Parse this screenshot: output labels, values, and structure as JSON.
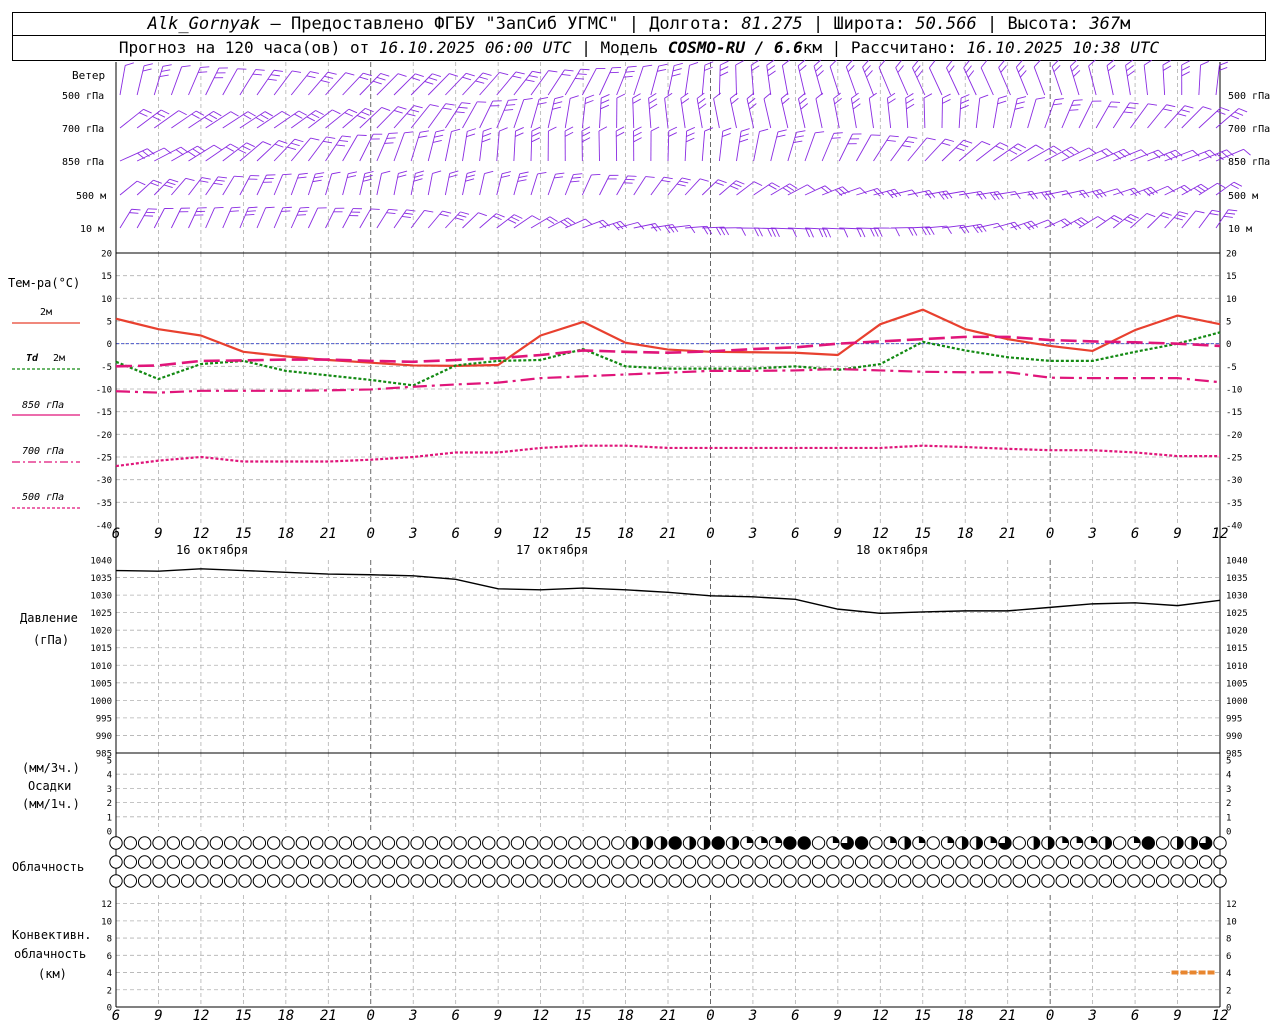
{
  "header": {
    "line1": {
      "station": "Alk_Gornyak",
      "provided_by": " – Предоставлено ФГБУ \"ЗапСиб УГМС\" | Долгота: ",
      "longitude": "81.275",
      "lat_label": " | Широта: ",
      "latitude": "50.566",
      "alt_label": " | Высота: ",
      "altitude": "367",
      "alt_unit": "м"
    },
    "line2": {
      "forecast_prefix": "Прогноз на 120 часа(ов) от ",
      "forecast_start": "16.10.2025 06:00 UTC",
      "model_label": " | Модель ",
      "model": "COSMO-RU / 6.6",
      "model_unit": "км",
      "computed_label": " | Рассчитано: ",
      "computed": "16.10.2025 10:38 UTC"
    }
  },
  "labels": {
    "wind": "Ветер",
    "wind_levels": [
      "500 гПа",
      "700 гПа",
      "850 гПа",
      "500 м",
      "10 м"
    ],
    "temp_title": "Тем-ра(°C)",
    "legend_t2m": "2м",
    "legend_td": "Td",
    "legend_td_suffix": "2м",
    "legend_850": "850 гПа",
    "legend_700": "700 гПа",
    "legend_500": "500 гПа",
    "pressure_title": "Давление",
    "pressure_unit": "(гПа)",
    "precip_unit1": "(мм/3ч.)",
    "precip_title": "Осадки",
    "precip_unit2": "(мм/1ч.)",
    "cloud_title": "Облачность",
    "conv_title1": "Конвективн.",
    "conv_title2": "облачность",
    "conv_unit": "(км)"
  },
  "colors": {
    "wind": "#8a2be2",
    "t2m": "#e8402f",
    "td2m": "#138a13",
    "t850": "#e0157a",
    "t700": "#e0157a",
    "t500": "#e0157a",
    "pressure": "#000000",
    "convective": "#e8862f",
    "grid": "#b0b0b0"
  },
  "chart_data": [
    {
      "type": "line",
      "title": "Тем-ра(°C)",
      "ylim": [
        -40,
        20
      ],
      "yticks": [
        20,
        15,
        10,
        5,
        0,
        -5,
        -10,
        -15,
        -20,
        -25,
        -30,
        -35,
        -40
      ],
      "x_ticks": [
        "6",
        "9",
        "12",
        "15",
        "18",
        "21",
        "0",
        "3",
        "6",
        "9",
        "12",
        "15",
        "18",
        "21",
        "0",
        "3",
        "6",
        "9",
        "12",
        "15",
        "18",
        "21",
        "0",
        "3",
        "6",
        "9",
        "12"
      ],
      "day_labels": [
        "16 октября",
        "17 октября",
        "18 октября"
      ],
      "x_hours": [
        0,
        3,
        6,
        9,
        12,
        15,
        18,
        21,
        24,
        27,
        30,
        33,
        36,
        39,
        42,
        45,
        48,
        51,
        54,
        57,
        60,
        63,
        66,
        69,
        72,
        75,
        78
      ],
      "series": [
        {
          "name": "2м",
          "values": [
            5.5,
            3.2,
            1.8,
            -1.8,
            -2.8,
            -3.6,
            -4.2,
            -4.8,
            -4.9,
            -4.7,
            1.8,
            4.8,
            0.2,
            -1.3,
            -1.8,
            -1.9,
            -2.0,
            -2.5,
            4.3,
            7.5,
            3.2,
            1.0,
            -0.5,
            -1.6,
            3.0,
            6.2,
            4.3
          ]
        },
        {
          "name": "Td 2м",
          "values": [
            -4.0,
            -7.8,
            -4.5,
            -3.8,
            -6.0,
            -7.0,
            -8.0,
            -9.2,
            -4.8,
            -3.8,
            -3.6,
            -1.2,
            -5.0,
            -5.5,
            -5.5,
            -5.5,
            -5.0,
            -5.8,
            -4.5,
            0.4,
            -1.5,
            -3.0,
            -3.8,
            -3.8,
            -1.8,
            0.0,
            2.5
          ]
        },
        {
          "name": "850 гПа",
          "values": [
            -10.5,
            -10.8,
            -10.4,
            -10.4,
            -10.4,
            -10.3,
            -10.1,
            -9.5,
            -9.0,
            -8.6,
            -7.6,
            -7.2,
            -6.8,
            -6.4,
            -6.0,
            -6.0,
            -5.9,
            -5.6,
            -5.9,
            -6.2,
            -6.3,
            -6.3,
            -7.5,
            -7.6,
            -7.6,
            -7.6,
            -8.5
          ]
        },
        {
          "name": "700 гПа",
          "values": [
            -5.0,
            -4.8,
            -3.8,
            -3.7,
            -3.5,
            -3.5,
            -3.8,
            -4.0,
            -3.6,
            -3.2,
            -2.5,
            -1.5,
            -1.8,
            -2.0,
            -1.7,
            -1.2,
            -0.8,
            0.0,
            0.5,
            1.0,
            1.5,
            1.5,
            0.8,
            0.5,
            0.3,
            0.0,
            -0.5
          ]
        },
        {
          "name": "500 гПа",
          "values": [
            -27.0,
            -25.8,
            -25.0,
            -26.0,
            -26.0,
            -26.0,
            -25.6,
            -25.0,
            -24.0,
            -24.0,
            -23.0,
            -22.5,
            -22.5,
            -23.0,
            -23.0,
            -23.0,
            -23.0,
            -23.0,
            -23.0,
            -22.5,
            -22.8,
            -23.2,
            -23.5,
            -23.5,
            -24.0,
            -24.8,
            -24.8
          ]
        }
      ]
    },
    {
      "type": "line",
      "title": "Давление",
      "ylabel": "(гПа)",
      "ylim": [
        985,
        1040
      ],
      "yticks": [
        1040,
        1035,
        1030,
        1025,
        1020,
        1015,
        1010,
        1005,
        1000,
        995,
        990,
        985
      ],
      "x_hours": [
        0,
        3,
        6,
        9,
        12,
        15,
        18,
        21,
        24,
        27,
        30,
        33,
        36,
        39,
        42,
        45,
        48,
        51,
        54,
        57,
        60,
        63,
        66,
        69,
        72,
        75,
        78
      ],
      "series": [
        {
          "name": "Давление",
          "values": [
            1037.0,
            1036.8,
            1037.5,
            1037.0,
            1036.5,
            1036.0,
            1035.8,
            1035.5,
            1034.5,
            1031.8,
            1031.5,
            1032.0,
            1031.5,
            1030.8,
            1029.8,
            1029.5,
            1028.8,
            1026.0,
            1024.8,
            1025.2,
            1025.5,
            1025.5,
            1026.5,
            1027.5,
            1027.8,
            1027.0,
            1028.5
          ]
        }
      ]
    },
    {
      "type": "bar",
      "title": "Осадки",
      "ylim": [
        0,
        5
      ],
      "yticks": [
        5,
        4,
        3,
        2,
        1,
        0
      ],
      "series": []
    },
    {
      "type": "bar",
      "title": "Конвективн. облачность",
      "ylabel": "(км)",
      "ylim": [
        0,
        13
      ],
      "yticks": [
        12,
        10,
        8,
        6,
        4,
        2,
        0
      ],
      "series": [
        {
          "name": "Конвективн. облачность",
          "x_hours": [
            75,
            78
          ],
          "values": [
            4,
            4
          ]
        }
      ]
    }
  ],
  "cloud_rows": {
    "upper": "000000000000000000000000000000000000222422421114401340121012213022111201402230101332332211133344",
    "middle": "000000000000000000000000000000000000000000000000000000000000000000000000000000000000000000000000",
    "lower": "000000000000000000000000000000000000000000000000000000000000000000000000000000000000000000000000"
  }
}
